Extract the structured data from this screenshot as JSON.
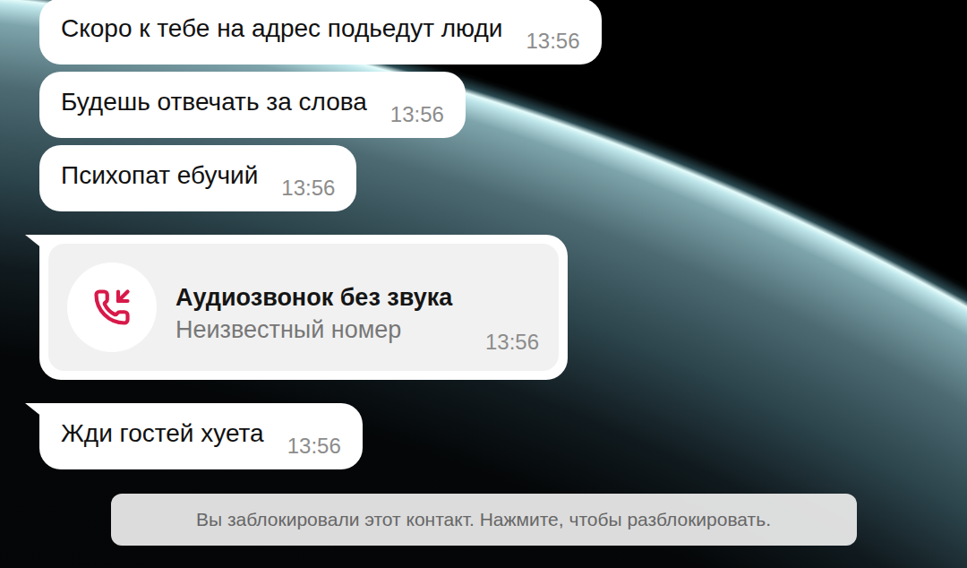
{
  "messages": [
    {
      "kind": "text",
      "text": "Скоро к тебе на адрес подьедут люди",
      "time": "13:56",
      "tail": false
    },
    {
      "kind": "text",
      "text": "Будешь отвечать за слова",
      "time": "13:56",
      "tail": false
    },
    {
      "kind": "text",
      "text": "Психопат ебучий",
      "time": "13:56",
      "tail": false
    },
    {
      "kind": "call",
      "title": "Аудиозвонок без звука",
      "subtitle": "Неизвестный номер",
      "time": "13:56",
      "tail": true
    },
    {
      "kind": "text",
      "text": "Жди гостей хуета",
      "time": "13:56",
      "tail": true
    }
  ],
  "notice": {
    "text": "Вы заблокировали этот контакт. Нажмите, чтобы разблокировать."
  }
}
